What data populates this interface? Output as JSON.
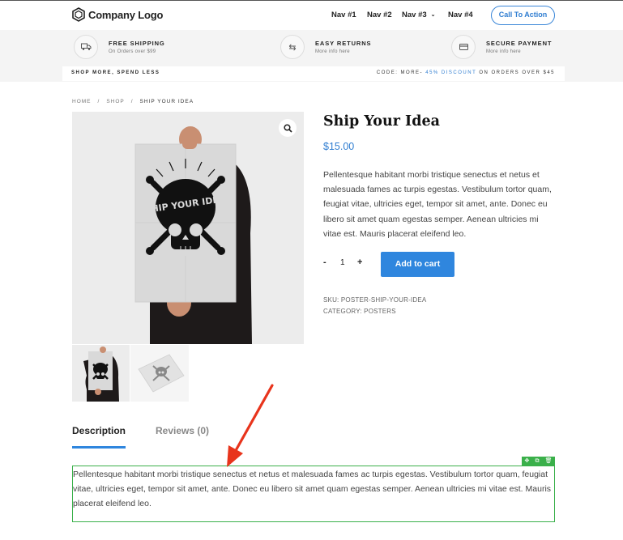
{
  "header": {
    "logo_text": "Company Logo",
    "nav": [
      "Nav #1",
      "Nav #2",
      "Nav #3",
      "Nav #4"
    ],
    "cta_label": "Call To Action"
  },
  "features": [
    {
      "title": "FREE SHIPPING",
      "subtitle": "On Orders over $99",
      "icon": "truck-icon"
    },
    {
      "title": "EASY RETURNS",
      "subtitle": "More info here",
      "icon": "swap-arrows-icon"
    },
    {
      "title": "SECURE PAYMENT",
      "subtitle": "More info here",
      "icon": "credit-card-icon"
    }
  ],
  "promo": {
    "left": "SHOP MORE, SPEND LESS",
    "right_prefix": "CODE: MORE-",
    "right_highlight": "45% DISCOUNT",
    "right_suffix": "ON ORDERS OVER $45"
  },
  "breadcrumb": [
    "HOME",
    "SHOP",
    "SHIP YOUR IDEA"
  ],
  "product": {
    "title": "Ship Your Idea",
    "price": "$15.00",
    "description": "Pellentesque habitant morbi tristique senectus et netus et malesuada fames ac turpis egestas. Vestibulum tortor quam, feugiat vitae, ultricies eget, tempor sit amet, ante. Donec eu libero sit amet quam egestas semper. Aenean ultricies mi vitae est. Mauris placerat eleifend leo.",
    "qty_minus": "-",
    "qty": "1",
    "qty_plus": "+",
    "add_to_cart": "Add to cart",
    "sku": "SKU: POSTER-SHIP-YOUR-IDEA",
    "category": "CATEGORY: POSTERS",
    "poster_text": "SHIP YOUR IDEA"
  },
  "tabs": {
    "description": "Description",
    "reviews": "Reviews (0)"
  },
  "long_description": "Pellentesque habitant morbi tristique senectus et netus et malesuada fames ac turpis egestas. Vestibulum tortor quam, feugiat vitae, ultricies eget, tempor sit amet, ante. Donec eu libero sit amet quam egestas semper. Aenean ultricies mi vitae est. Mauris placerat eleifend leo.",
  "editor_tools": [
    "move-icon",
    "duplicate-icon",
    "delete-icon"
  ],
  "colors": {
    "accent": "#2f86de",
    "selection": "#3ab04a",
    "arrow": "#e8341c"
  }
}
